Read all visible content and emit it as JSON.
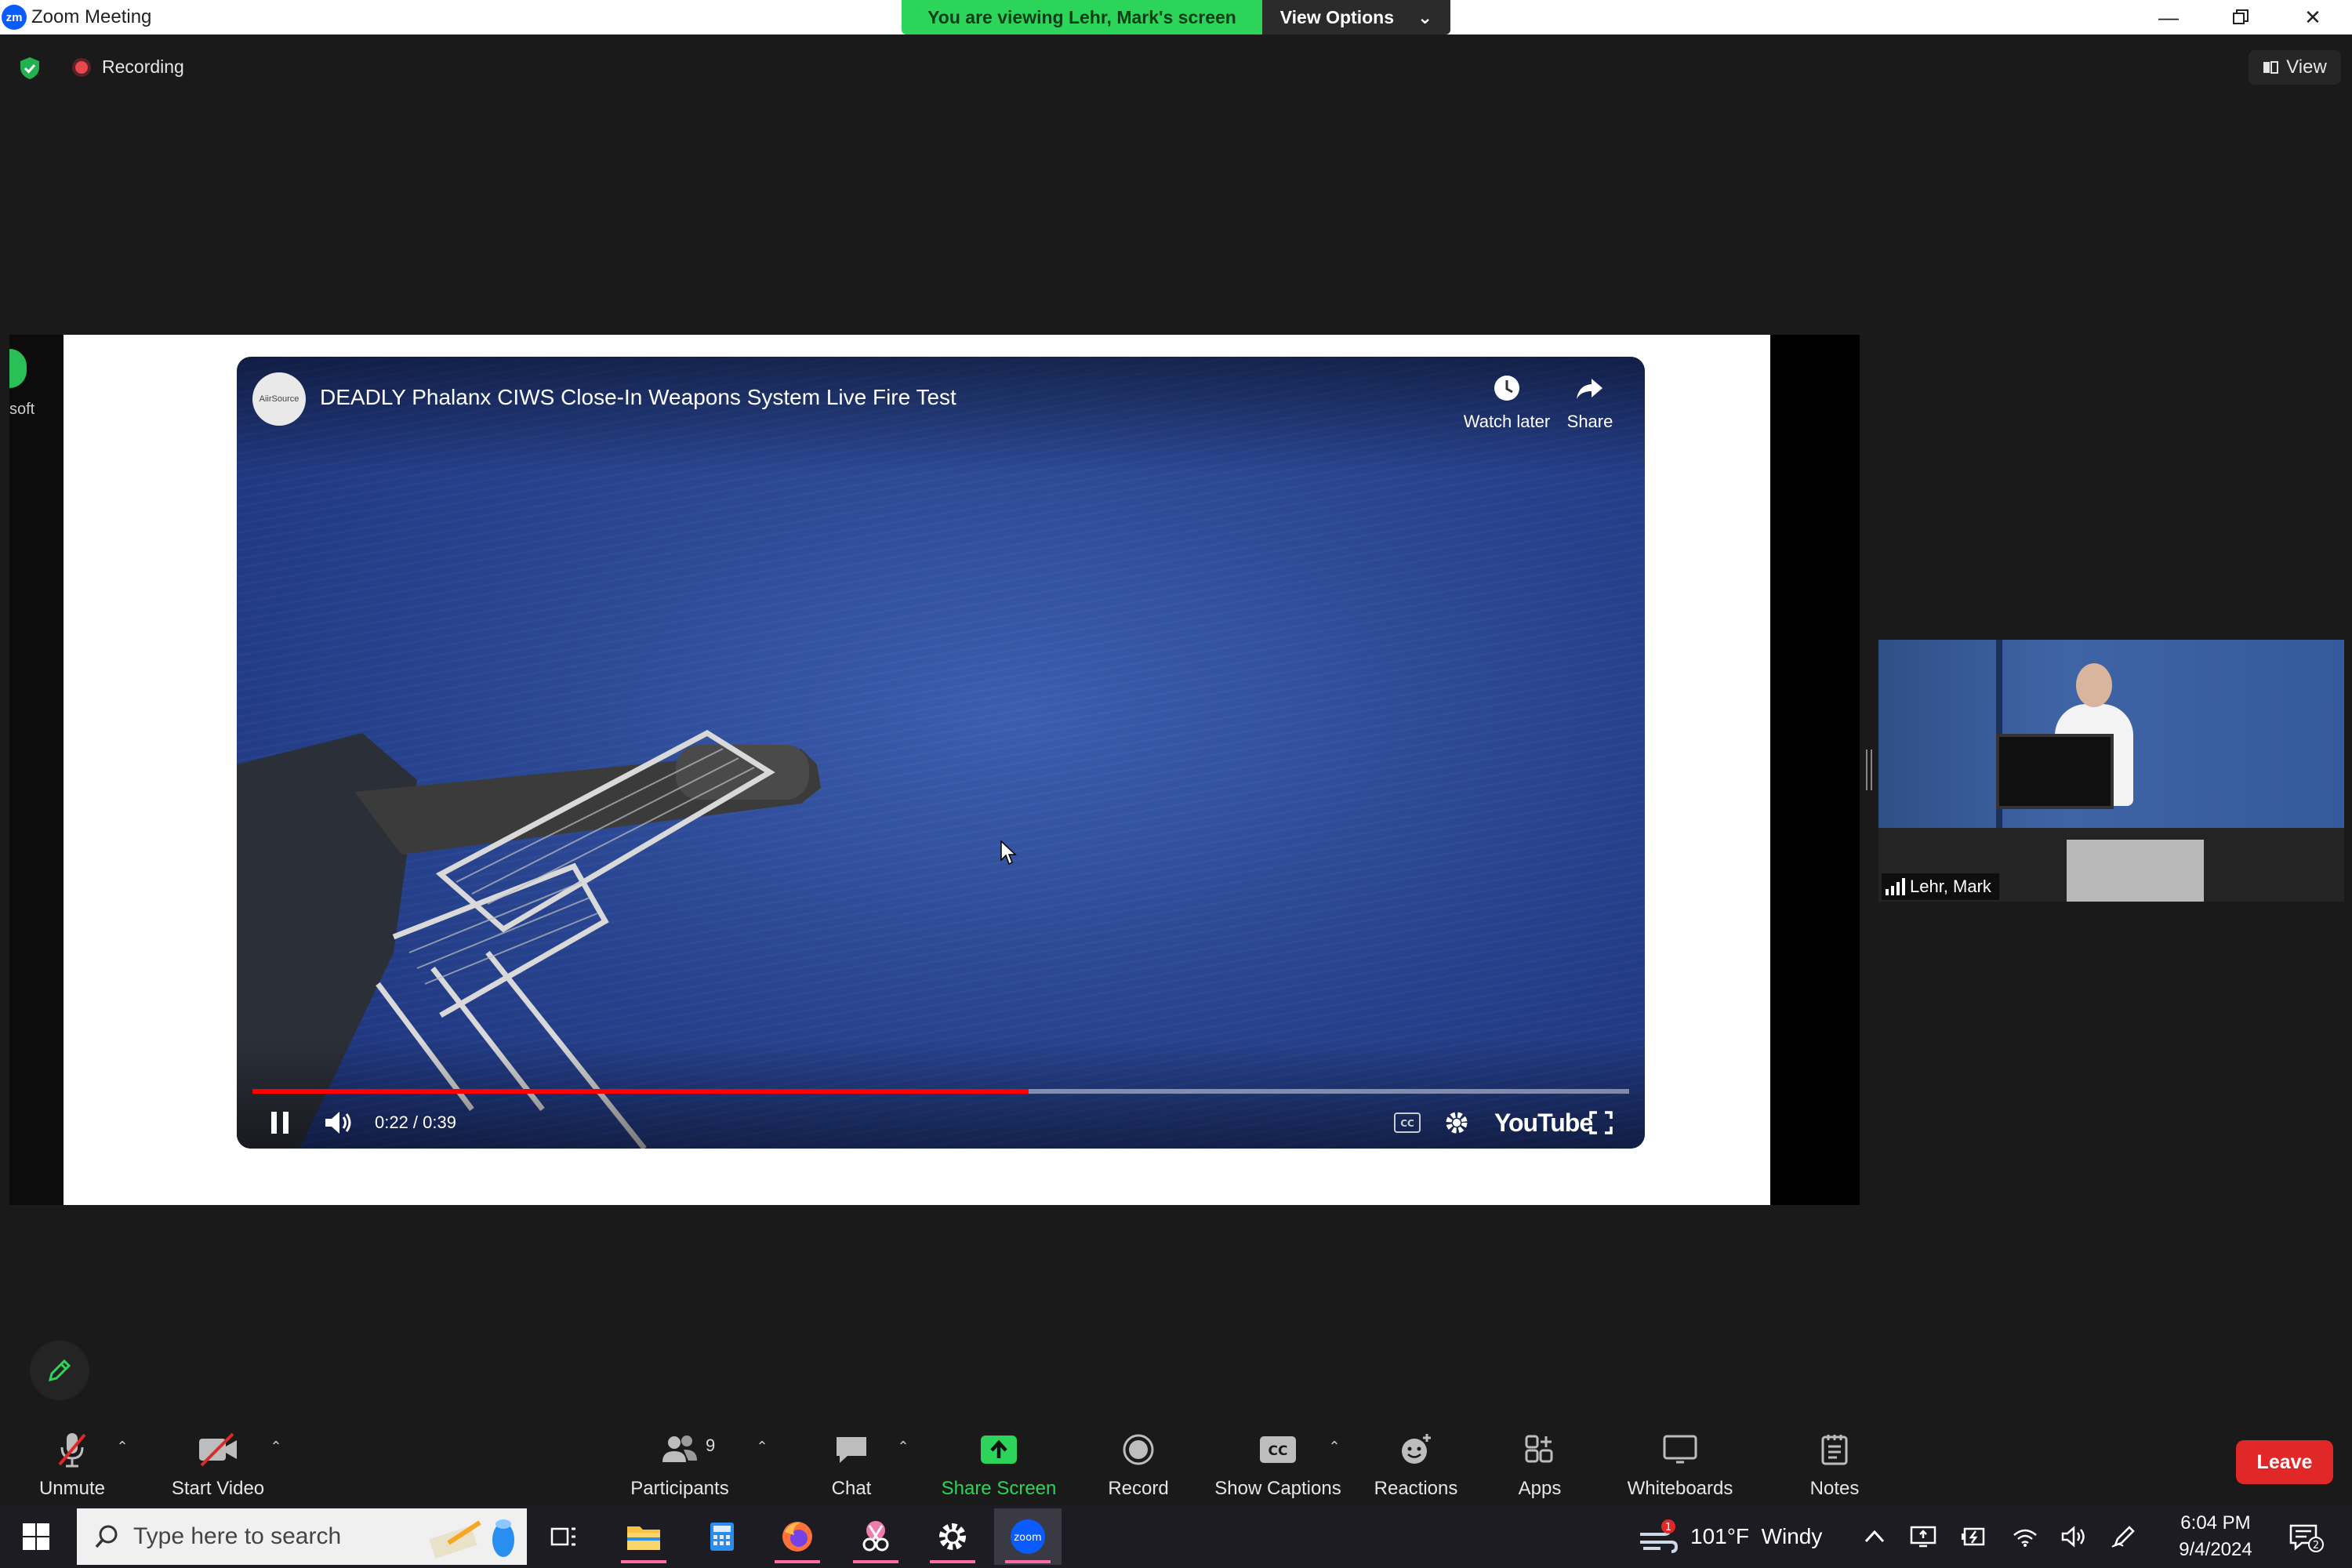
{
  "window": {
    "app_icon": "zm",
    "title": "Zoom Meeting",
    "banner": "You are viewing Lehr, Mark's screen",
    "view_options": "View Options"
  },
  "header": {
    "recording_label": "Recording",
    "view_label": "View"
  },
  "shared_screen": {
    "left_strip_text": "soft",
    "video": {
      "channel_avatar_text": "AiirSource",
      "title": "DEADLY Phalanx CIWS Close-In Weapons System Live Fire Test",
      "watch_later": "Watch later",
      "share": "Share",
      "time": "0:22 / 0:39",
      "progress_fraction": 0.564,
      "platform_logo": "YouTube"
    }
  },
  "participant": {
    "name": "Lehr, Mark"
  },
  "toolbar": {
    "unmute": "Unmute",
    "start_video": "Start Video",
    "participants": "Participants",
    "participants_count": "9",
    "chat": "Chat",
    "share_screen": "Share Screen",
    "record": "Record",
    "show_captions": "Show Captions",
    "captions_icon_text": "CC",
    "reactions": "Reactions",
    "apps": "Apps",
    "whiteboards": "Whiteboards",
    "notes": "Notes",
    "leave": "Leave",
    "zoom_taskbar_label": "zoom"
  },
  "taskbar": {
    "search_placeholder": "Type here to search",
    "weather": "101°F  Windy",
    "weather_badge": "1",
    "time": "6:04 PM",
    "date": "9/4/2024",
    "notification_count": "2"
  },
  "colors": {
    "banner_green": "#2dd45a",
    "share_screen_green": "#2dd45a",
    "leave_red": "#e02828",
    "progress_red": "#ff0000",
    "accent_blue": "#0b5cff"
  }
}
